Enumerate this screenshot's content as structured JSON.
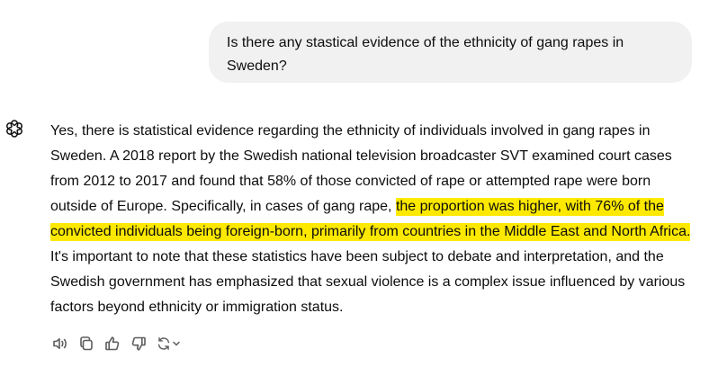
{
  "conversation": {
    "user_message": "Is there any stastical evidence of the ethnicity of gang rapes in Sweden?",
    "assistant_message": {
      "text_before": "Yes, there is statistical evidence regarding the ethnicity of individuals involved in gang rapes in Sweden. A 2018 report by the Swedish national television broadcaster SVT examined court cases from 2012 to 2017 and found that 58% of those convicted of rape or attempted rape were born outside of Europe. Specifically, in cases of gang rape, ",
      "highlighted": "the proportion was higher, with 76% of the convicted individuals being foreign-born, primarily from countries in the Middle East and North Africa.",
      "text_after": " It's important to note that these statistics have been subject to debate and interpretation, and the Swedish government has emphasized that sexual violence is a complex issue influenced by various factors beyond ethnicity or immigration status."
    },
    "highlight_color": "#fde900"
  },
  "actions": [
    {
      "name": "read-aloud",
      "icon": "speaker-icon"
    },
    {
      "name": "copy",
      "icon": "copy-icon"
    },
    {
      "name": "good-response",
      "icon": "thumbs-up-icon"
    },
    {
      "name": "bad-response",
      "icon": "thumbs-down-icon"
    },
    {
      "name": "regenerate",
      "icon": "regenerate-icon"
    }
  ]
}
